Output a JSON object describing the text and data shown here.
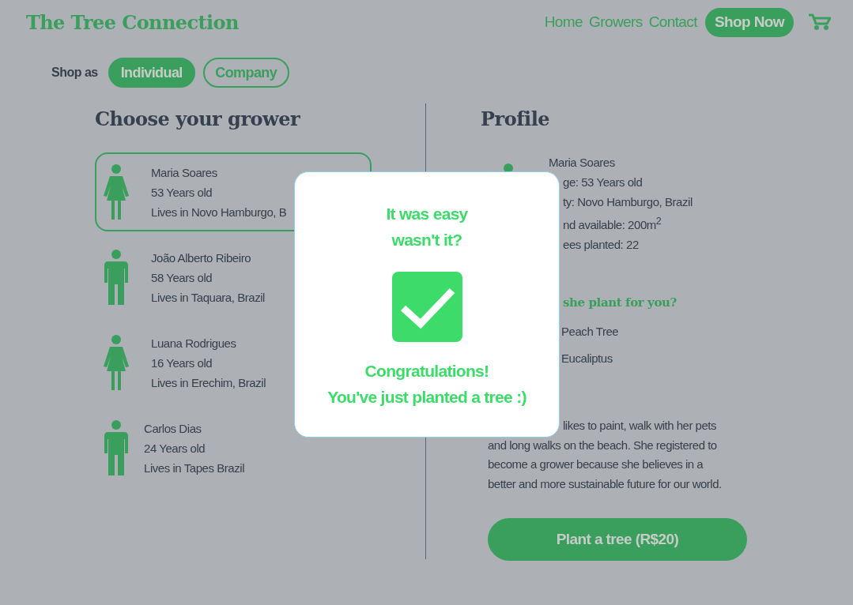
{
  "header": {
    "title": "The Tree Connection",
    "nav": [
      {
        "label": "Home",
        "kind": "link"
      },
      {
        "label": "Growers",
        "kind": "link"
      },
      {
        "label": "Contact",
        "kind": "link"
      },
      {
        "label": "Shop Now",
        "kind": "cta"
      }
    ]
  },
  "shop_as": {
    "label": "Shop as",
    "options": [
      {
        "label": "Individual",
        "selected": true
      },
      {
        "label": "Company",
        "selected": false
      }
    ]
  },
  "growers": {
    "heading": "Choose your grower",
    "items": [
      {
        "name": "Maria Soares",
        "age": "53 Years old",
        "city": "Lives in Novo Hamburgo, B",
        "kind": "female",
        "selected": true
      },
      {
        "name": "João Alberto Ribeiro",
        "age": "58 Years old",
        "city": "Lives in Taquara, Brazil",
        "kind": "male",
        "selected": false
      },
      {
        "name": "Luana Rodrigues",
        "age": "16 Years old",
        "city": "Lives in Erechim, Brazil",
        "kind": "female",
        "selected": false
      },
      {
        "name": "Carlos Dias",
        "age": "24 Years old",
        "city": "Lives in Tapes Brazil",
        "kind": "male",
        "selected": false
      }
    ]
  },
  "profile": {
    "heading": "Profile",
    "name": "Maria Soares",
    "details": [
      "ge: 53 Years old",
      "ty: Novo Hamburgo, Brazil",
      "nd available: 200m$^{2}$",
      "ees planted: 22"
    ],
    "trees_heading": "she plant for you?",
    "trees": [
      "Peach Tree",
      "Eucaliptus"
    ],
    "bio_lines": [
      "likes to paint, walk with her pets",
      "and long walks on the beach. She registered to",
      "become a grower because she believes in a",
      "better and more sustainable future for our world."
    ],
    "button": "Plant a tree (R$20)"
  },
  "modal": {
    "title": "It was easy\nwasn't it?",
    "message": "Congratulations!\nYou've just planted a tree :)"
  }
}
